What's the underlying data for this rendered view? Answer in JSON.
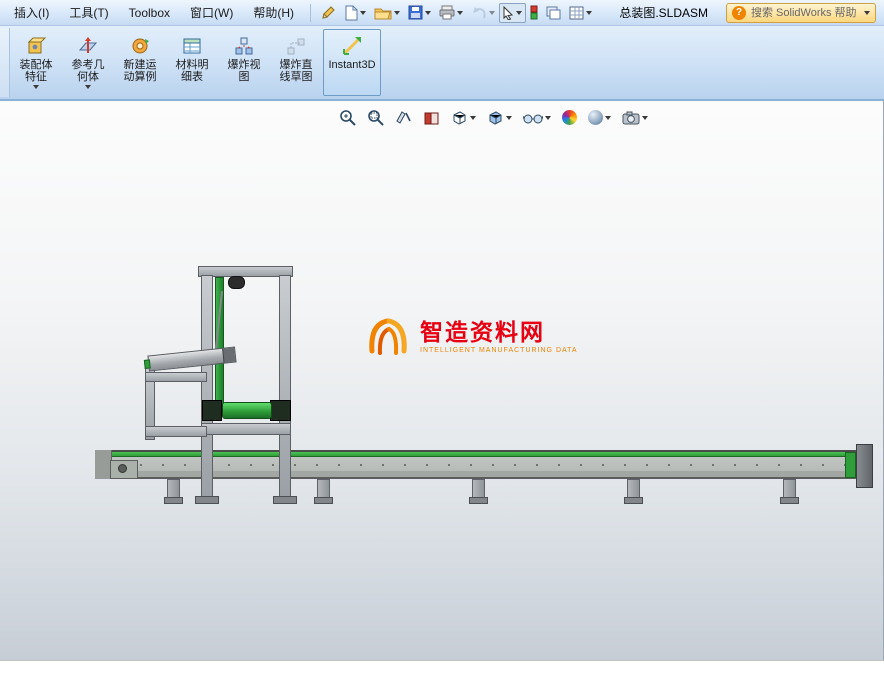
{
  "window": {
    "title": "总装图.SLDASM",
    "search_placeholder": "搜索 SolidWorks 帮助"
  },
  "menubar": {
    "items": [
      {
        "id": "insert",
        "label": "插入(I)"
      },
      {
        "id": "tools",
        "label": "工具(T)"
      },
      {
        "id": "toolbox",
        "label": "Toolbox"
      },
      {
        "id": "window",
        "label": "窗口(W)"
      },
      {
        "id": "help",
        "label": "帮助(H)"
      }
    ]
  },
  "toolbar": {
    "icons": [
      "sketch-pencil",
      "new-document",
      "open",
      "save",
      "print",
      "undo",
      "select",
      "rebuild",
      "view-palette",
      "sheet-properties"
    ]
  },
  "command_manager": {
    "buttons": [
      {
        "label": "装配体\n特征",
        "has_dropdown": true,
        "active": false
      },
      {
        "label": "参考几\n何体",
        "has_dropdown": true,
        "active": false
      },
      {
        "label": "新建运\n动算例",
        "has_dropdown": false,
        "active": false
      },
      {
        "label": "材料明\n细表",
        "has_dropdown": false,
        "active": false
      },
      {
        "label": "爆炸视\n图",
        "has_dropdown": false,
        "active": false
      },
      {
        "label": "爆炸直\n线草图",
        "has_dropdown": false,
        "active": false
      },
      {
        "label": "Instant3D",
        "has_dropdown": false,
        "active": true
      }
    ]
  },
  "hud_toolbar": {
    "icons": [
      "zoom-fit",
      "zoom-area",
      "previous-view",
      "section-view",
      "view-orientation",
      "display-style",
      "hide-show-items",
      "edit-appearance",
      "apply-scene",
      "view-settings"
    ]
  },
  "watermark": {
    "title": "智造资料网",
    "subtitle": "INTELLIGENT MANUFACTURING DATA"
  },
  "colors": {
    "menubar_top": "#eef5fd",
    "menubar_bottom": "#c6dbf3",
    "cmdbar_top": "#e2eefb",
    "cmdbar_bottom": "#b9d2ee",
    "active_button_border": "#6f9bc9",
    "viewport_bottom": "#c6cdd5",
    "machine_green": "#2f9e3a",
    "watermark_red": "#e60012",
    "watermark_orange": "#f08300",
    "search_bg": "#fbd77e"
  }
}
